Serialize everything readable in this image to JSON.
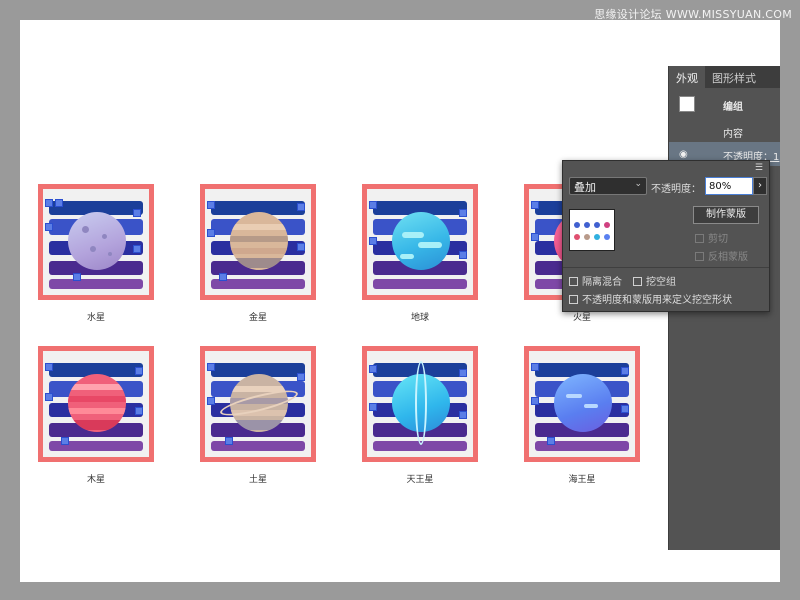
{
  "watermark": "思缘设计论坛 WWW.MISSYUAN.COM",
  "planets": [
    {
      "label": "水星"
    },
    {
      "label": "金星"
    },
    {
      "label": "地球"
    },
    {
      "label": "火星"
    },
    {
      "label": "木星"
    },
    {
      "label": "土星"
    },
    {
      "label": "天王星"
    },
    {
      "label": "海王星"
    }
  ],
  "appearance_panel": {
    "tabs": [
      "外观",
      "图形样式"
    ],
    "group_label": "编组",
    "content_label": "内容",
    "opacity_row": "不透明度：1"
  },
  "transparency_popup": {
    "blend_mode": "叠加",
    "opacity_label": "不透明度：",
    "opacity_value": "80%",
    "make_mask_button": "制作蒙版",
    "clip_label": "剪切",
    "invert_mask_label": "反相蒙版",
    "isolate_blending_label": "隔离混合",
    "knockout_group_label": "挖空组",
    "opacity_mask_knockout_label": "不透明度和蒙版用来定义挖空形状"
  }
}
